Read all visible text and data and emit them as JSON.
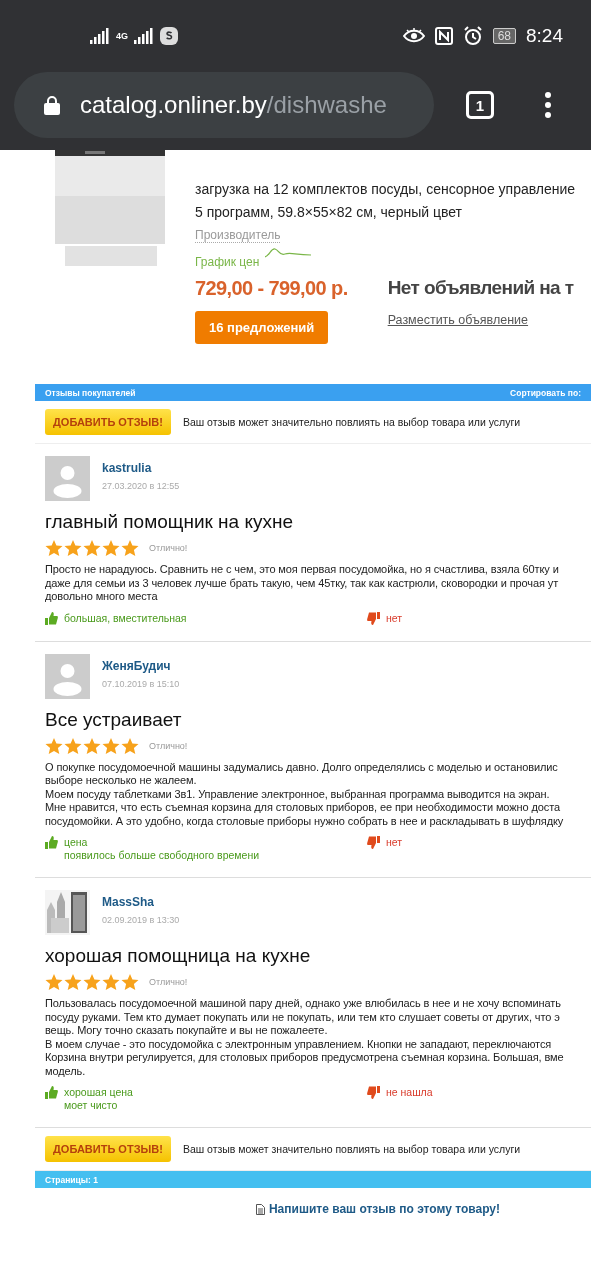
{
  "status_bar": {
    "network": "4G",
    "battery": "68",
    "time": "8:24"
  },
  "browser": {
    "url_host": "catalog.onliner.by",
    "url_path": "/dishwashe",
    "tab_count": "1"
  },
  "product": {
    "specs": [
      "загрузка на 12 комплектов посуды, сенсорное управление",
      "5 программ, 59.8×55×82 см, черный цвет"
    ],
    "manufacturer": "Производитель",
    "price_chart": "График цен",
    "price": "729,00 - 799,00 р.",
    "offers_button": "16 предложений",
    "no_ads": "Нет объявлений на т",
    "post_ad": "Разместить объявление"
  },
  "reviews": {
    "header": {
      "title": "Отзывы покупателей",
      "sort_label": "Сортировать по:"
    },
    "add_bar": {
      "button": "ДОБАВИТЬ ОТЗЫВ!",
      "hint": "Ваш отзыв может значительно повлиять на выбор товара или услуги"
    },
    "items": [
      {
        "avatar": {
          "kind": "placeholder"
        },
        "author": "kastrulia",
        "date": "27.03.2020 в 12:55",
        "title": "главный помощник на кухне",
        "stars": 5,
        "verdict": "Отлично!",
        "body": [
          "Просто не нарадуюсь. Сравнить не с чем, это моя первая посудомойка, но я счастлива, взяла 60тку и",
          "даже для семьи из 3 человек лучше брать такую, чем 45тку, так как кастрюли, сковородки и прочая ут",
          "довольно много места"
        ],
        "pros": [
          "большая, вместительная"
        ],
        "cons": [
          "нет"
        ]
      },
      {
        "avatar": {
          "kind": "placeholder"
        },
        "author": "ЖеняБудич",
        "date": "07.10.2019 в 15:10",
        "title": "Все устраивает",
        "stars": 5,
        "verdict": "Отлично!",
        "body": [
          "О покупке посудомоечной машины задумались давно. Долго определялись с моделью и остановилис",
          "выборе несколько не жалеем.",
          "Моем посуду таблетками 3в1. Управление электронное, выбранная программа выводится на экран.",
          "Мне нравится, что есть съемная корзина для столовых приборов, ее при необходимости можно доста",
          "посудомойки. А это удобно, когда столовые приборы нужно собрать в нее и раскладывать в шуфлядку"
        ],
        "pros": [
          "цена",
          "появилось больше свободного времени"
        ],
        "cons": [
          "нет"
        ]
      },
      {
        "avatar": {
          "kind": "picture"
        },
        "author": "MassSha",
        "date": "02.09.2019 в 13:30",
        "title": "хорошая помощница на кухне",
        "stars": 5,
        "verdict": "Отлично!",
        "body": [
          "Пользовалась посудомоечной машиной пару дней, однако уже влюбилась в нее и не хочу вспоминать",
          "посуду руками. Тем кто думает покупать или не покупать, или тем кто слушает советы от других, что э",
          "вещь. Могу точно сказать покупайте и вы не пожалеете.",
          "В моем случае - это посудомойка с электронным управлением. Кнопки не западают, переключаются",
          "Корзина внутри регулируется, для столовых приборов предусмотрена съемная корзина. Большая, вме",
          "модель."
        ],
        "pros": [
          "хорошая цена",
          "моет чисто"
        ],
        "cons": [
          "не нашла"
        ]
      }
    ],
    "add_bar_bottom": {
      "button": "ДОБАВИТЬ ОТЗЫВ!",
      "hint": "Ваш отзыв может значительно повлиять на выбор товара или услуги"
    },
    "pages": "Страницы: 1",
    "write_link": "Напишите ваш отзыв по этому товару!"
  }
}
